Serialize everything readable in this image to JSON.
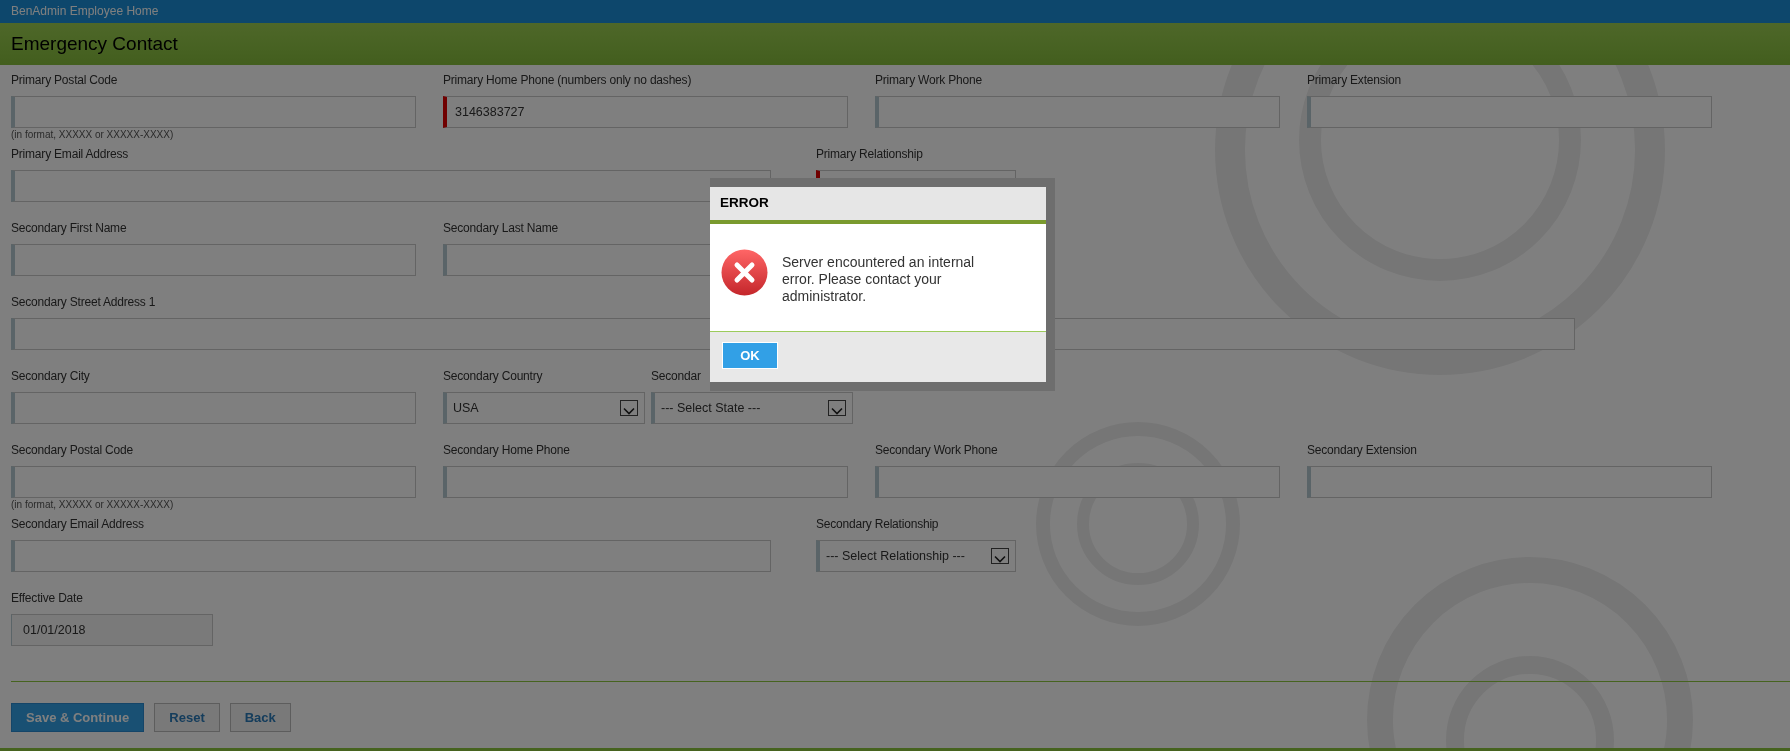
{
  "header": {
    "title": "BenAdmin Employee Home"
  },
  "page_title": "Emergency Contact",
  "rows": [
    {
      "fields": [
        {
          "kind": "text",
          "label": "Primary Postal Code",
          "required": false,
          "hint": "(in format, XXXXX or XXXXX-XXXX)"
        },
        {
          "kind": "text",
          "label": "Primary Home Phone (numbers only no dashes)",
          "required": true,
          "value": "3146383727"
        },
        {
          "kind": "text",
          "label": "Primary Work Phone",
          "required": false
        },
        {
          "kind": "text",
          "label": "Primary Extension",
          "required": false
        }
      ]
    },
    {
      "fields": [
        {
          "kind": "text",
          "label": "Primary Email Address",
          "required": false
        },
        {
          "kind": "select",
          "label": "Primary Relationship",
          "required": true
        }
      ]
    },
    {
      "fields": [
        {
          "kind": "text",
          "label": "Secondary First Name",
          "required": false
        },
        {
          "kind": "text",
          "label": "Secondary Last Name",
          "required": false
        }
      ]
    },
    {
      "fields": [
        {
          "kind": "text",
          "label": "Secondary Street Address 1",
          "required": false
        }
      ]
    },
    {
      "fields": [
        {
          "kind": "text",
          "label": "Secondary City",
          "required": false
        },
        {
          "kind": "select",
          "label": "Secondary Country",
          "required": false,
          "value": "USA"
        },
        {
          "kind": "select",
          "label": "Secondar",
          "required": false,
          "value": "--- Select State ---"
        }
      ]
    },
    {
      "fields": [
        {
          "kind": "text",
          "label": "Secondary Postal Code",
          "required": false,
          "hint": "(in format, XXXXX or XXXXX-XXXX)"
        },
        {
          "kind": "text",
          "label": "Secondary Home Phone",
          "required": false
        },
        {
          "kind": "text",
          "label": "Secondary Work Phone",
          "required": false
        },
        {
          "kind": "text",
          "label": "Secondary Extension",
          "required": false
        }
      ]
    },
    {
      "fields": [
        {
          "kind": "text",
          "label": "Secondary Email Address",
          "required": false
        },
        {
          "kind": "select",
          "label": "Secondary Relationship",
          "required": false,
          "value": "--- Select Relationship ---"
        }
      ]
    },
    {
      "fields": [
        {
          "kind": "date",
          "label": "Effective Date",
          "required": false,
          "value": "01/01/2018"
        }
      ]
    }
  ],
  "buttons": [
    {
      "label": "Save & Continue",
      "primary": true
    },
    {
      "label": "Reset",
      "primary": false
    },
    {
      "label": "Back",
      "primary": false
    }
  ],
  "dialog": {
    "title": "ERROR",
    "message": "Server encountered an internal error. Please contact your administrator.",
    "button": "OK"
  }
}
